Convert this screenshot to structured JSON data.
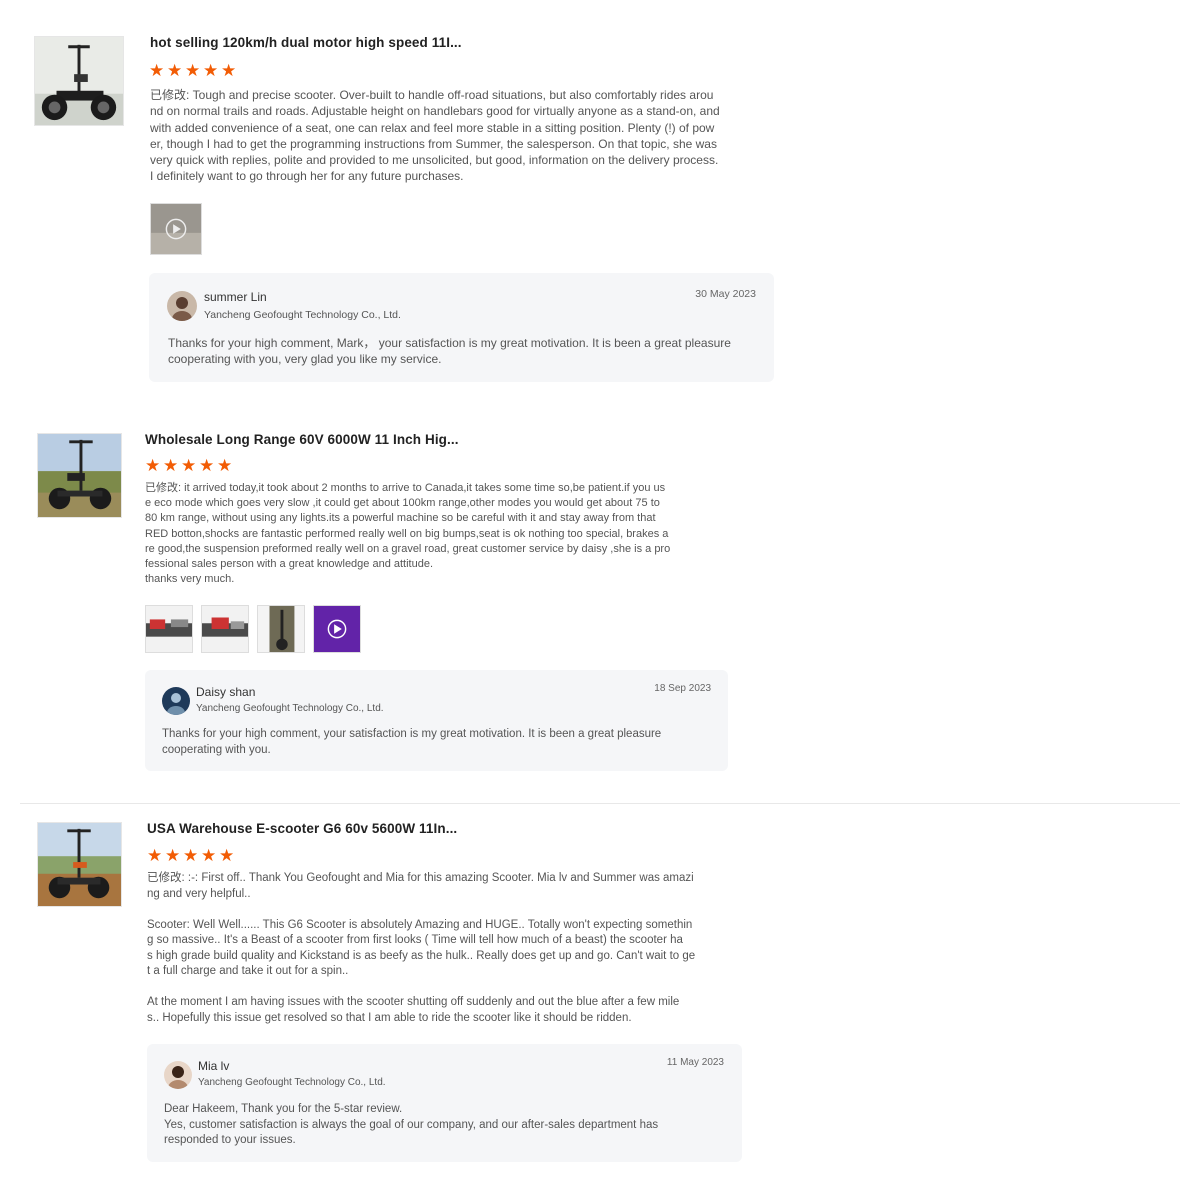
{
  "reviews": [
    {
      "title": "hot selling 120km/h dual motor high speed 11I...",
      "rating": 5,
      "prefix": "已修改:",
      "text": " Tough and precise scooter. Over-built to handle off-road situations, but also comfortably rides arou\nnd on normal trails and roads. Adjustable height on handlebars good for virtually anyone as a stand-on, and\nwith added convenience of a seat, one can relax and feel more stable in a sitting position. Plenty (!) of pow\ner, though I had to get the programming instructions from Summer, the salesperson. On that topic, she was\nvery quick with replies, polite and provided to me unsolicited, but good, information on the delivery process.\nI definitely want to go through her for any future purchases.",
      "media_count": 1,
      "reply": {
        "name": "summer Lin",
        "company": "Yancheng Geofought Technology Co., Ltd.",
        "date": "30 May 2023",
        "text": "Thanks for your high comment, Mark，  your satisfaction is my great motivation. It is been a great pleasure\ncooperating with you, very glad you like my service."
      }
    },
    {
      "title": "Wholesale Long Range 60V 6000W 11 Inch Hig...",
      "rating": 5,
      "prefix": "已修改:",
      "text": " it arrived today,it took about 2 months to arrive to Canada,it takes some time so,be patient.if you us\ne eco mode which goes very slow ,it could get about 100km range,other modes you would get about 75 to\n80 km range, without using any lights.its a powerful machine so be careful with it and stay away from that\nRED botton,shocks are fantastic performed really well on big bumps,seat is ok nothing too special, brakes a\nre good,the suspension preformed really well on a gravel road, great customer service by daisy ,she is a pro\nfessional sales person with a great knowledge and attitude.\nthanks very much.",
      "media_count": 4,
      "reply": {
        "name": "Daisy shan",
        "company": "Yancheng Geofought Technology Co., Ltd.",
        "date": "18 Sep 2023",
        "text": "Thanks for your high comment, your satisfaction is my great motivation. It is been a great pleasure\ncooperating with you."
      }
    },
    {
      "title": "USA Warehouse E-scooter G6 60v 5600W 11In...",
      "rating": 5,
      "prefix": "已修改:",
      "text": " :-: First off.. Thank You Geofought and Mia for this amazing Scooter. Mia lv and Summer was amazi\nng and very helpful..\n\nScooter: Well Well...... This G6 Scooter is absolutely Amazing and HUGE.. Totally won't expecting somethin\ng so massive..  It's a Beast of a scooter from first looks ( Time will tell how much of a beast) the scooter ha\ns high grade build quality and Kickstand is as beefy as the hulk.. Really does get up and go. Can't wait to ge\nt a full charge and take it out for a spin..\n\nAt the moment I am having issues with the scooter shutting off suddenly and out the blue after a few mile\ns.. Hopefully this issue get resolved so that I am able to ride the scooter like it should be ridden.",
      "media_count": 0,
      "reply": {
        "name": "Mia lv",
        "company": "Yancheng Geofought Technology Co., Ltd.",
        "date": "11 May 2023",
        "text": "Dear Hakeem, Thank you for the 5-star review.\nYes, customer satisfaction is always the goal of our company, and our after-sales department has\nresponded to your issues."
      }
    }
  ],
  "icons": {
    "star": "star-icon",
    "play": "play-icon"
  },
  "colors": {
    "star": "#f25c05",
    "reply_bg": "#f5f6f8",
    "video_tint": "#8a2be2"
  }
}
